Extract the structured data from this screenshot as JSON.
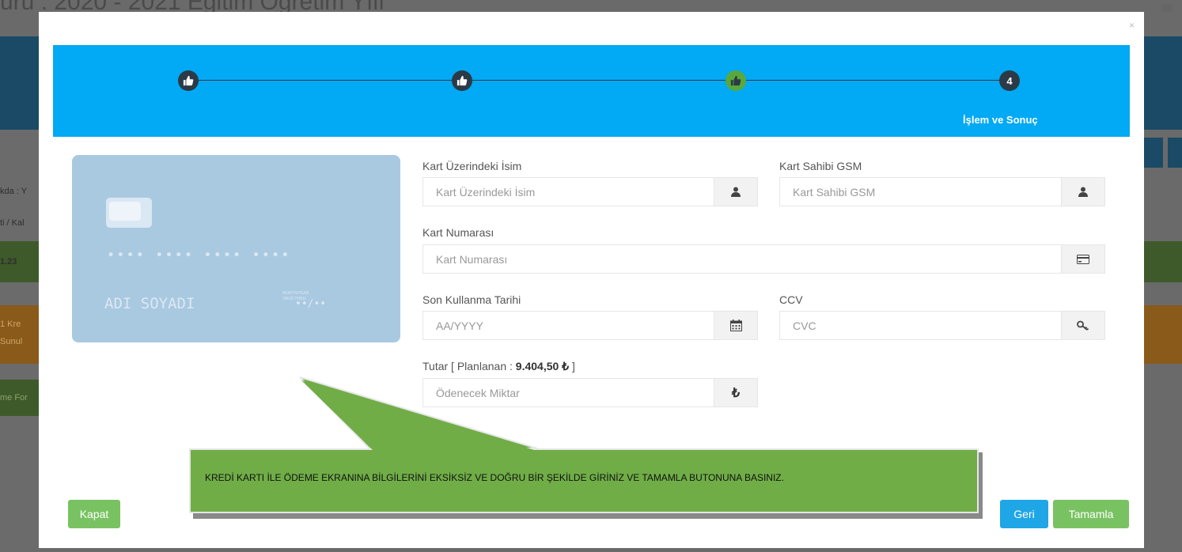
{
  "background": {
    "title": "uru : 2020 - 2021 Eğitim Öğretim Yılı",
    "lines": [
      "kda : Y",
      "ti / Kal",
      "1.23",
      "1 Kre",
      "Sunul",
      "me For"
    ]
  },
  "modal": {
    "close_label": "×",
    "wizard": {
      "active_step_number": "4",
      "active_step_label": "İşlem ve Sonuç",
      "steps": [
        {
          "icon": "thumbs-up-icon",
          "state": "completed",
          "color": "#2b3a46"
        },
        {
          "icon": "thumbs-up-icon",
          "state": "completed",
          "color": "#2b3a46"
        },
        {
          "icon": "thumbs-up-icon",
          "state": "completed",
          "color": "#59a83c"
        },
        {
          "number": "4",
          "state": "active",
          "color": "#2b3a46"
        }
      ],
      "background_color": "#02a9f4"
    },
    "card_preview": {
      "number": "•••• •••• •••• ••••",
      "name": "ADI SOYADI",
      "valid_thru_label": "VALID THRU",
      "month_year_label": "MONTH/YEAR",
      "expiry": "••/••"
    },
    "form": {
      "card_name_label": "Kart Üzerindeki İsim",
      "card_name_placeholder": "Kart Üzerindeki İsim",
      "gsm_label": "Kart Sahibi GSM",
      "gsm_placeholder": "Kart Sahibi GSM",
      "card_number_label": "Kart Numarası",
      "card_number_placeholder": "Kart Numarası",
      "expiry_label": "Son Kullanma Tarihi",
      "expiry_placeholder": "AA/YYYY",
      "ccv_label": "CCV",
      "ccv_placeholder": "CVC",
      "amount_label_prefix": "Tutar [ Planlanan : ",
      "amount_planned": "9.404,50 ₺",
      "amount_label_suffix": " ]",
      "amount_placeholder": "Ödenecek Miktar",
      "currency_symbol": "₺"
    },
    "callout": {
      "text": "KREDİ KARTI İLE ÖDEME EKRANINA BİLGİLERİNİ EKSİKSİZ VE DOĞRU BİR ŞEKİLDE GİRİNİZ VE TAMAMLA BUTONUNA BASINIZ.",
      "color": "#70ad47"
    },
    "footer": {
      "close_button": "Kapat",
      "back_button": "Geri",
      "complete_button": "Tamamla"
    }
  }
}
